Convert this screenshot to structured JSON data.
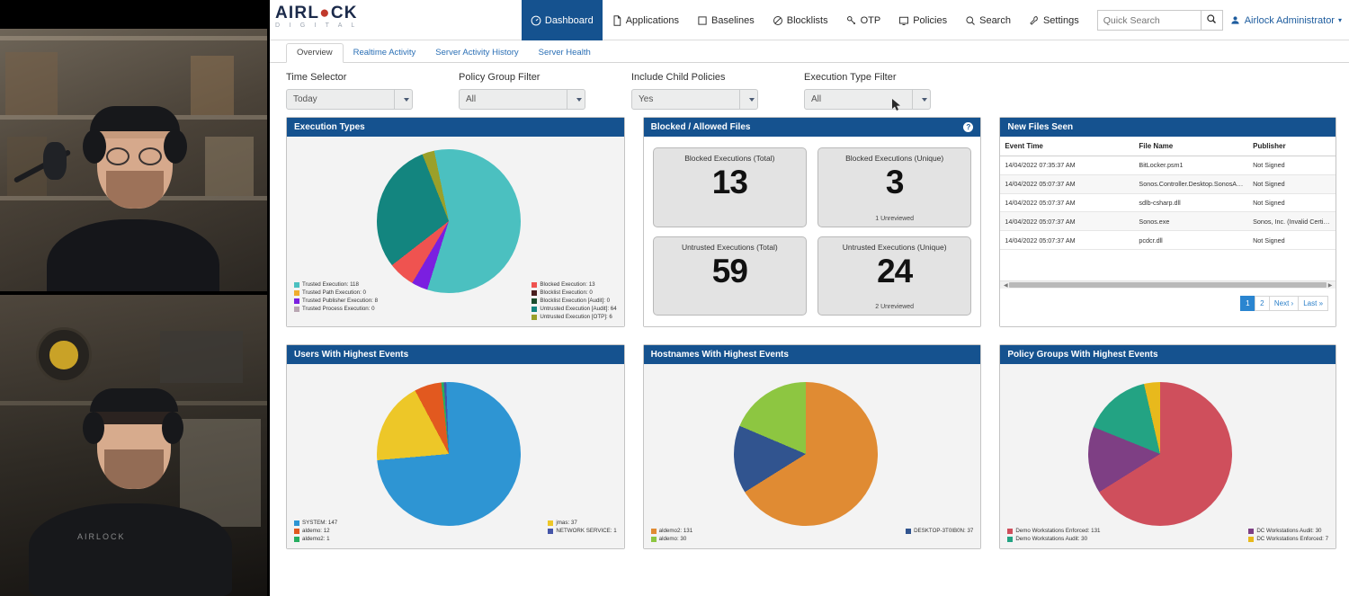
{
  "brand": {
    "name_a": "AIRL",
    "name_b": "CK",
    "tagline": "D I G I T A L"
  },
  "nav": {
    "items": [
      {
        "label": "Dashboard",
        "icon": "gauge-icon",
        "active": true
      },
      {
        "label": "Applications",
        "icon": "file-icon",
        "active": false
      },
      {
        "label": "Baselines",
        "icon": "square-icon",
        "active": false
      },
      {
        "label": "Blocklists",
        "icon": "ban-icon",
        "active": false
      },
      {
        "label": "OTP",
        "icon": "key-icon",
        "active": false
      },
      {
        "label": "Policies",
        "icon": "monitor-icon",
        "active": false
      },
      {
        "label": "Search",
        "icon": "search-icon",
        "active": false
      },
      {
        "label": "Settings",
        "icon": "wrench-icon",
        "active": false
      }
    ],
    "search": {
      "placeholder": "Quick Search",
      "value": "",
      "button_icon": "search-icon"
    },
    "user": {
      "label": "Airlock Administrator",
      "icon": "user-icon",
      "caret": "▾"
    }
  },
  "tabs": [
    {
      "label": "Overview",
      "active": true
    },
    {
      "label": "Realtime Activity",
      "active": false
    },
    {
      "label": "Server Activity History",
      "active": false
    },
    {
      "label": "Server Health",
      "active": false
    }
  ],
  "filters": [
    {
      "label": "Time Selector",
      "value": "Today"
    },
    {
      "label": "Policy Group Filter",
      "value": "All"
    },
    {
      "label": "Include Child Policies",
      "value": "Yes"
    },
    {
      "label": "Execution Type Filter",
      "value": "All"
    }
  ],
  "panels": {
    "execution_types": {
      "title": "Execution Types"
    },
    "blocked_allowed": {
      "title": "Blocked / Allowed Files",
      "help": "?"
    },
    "new_files": {
      "title": "New Files Seen"
    },
    "users": {
      "title": "Users With Highest Events"
    },
    "hostnames": {
      "title": "Hostnames With Highest Events"
    },
    "policy_groups": {
      "title": "Policy Groups With Highest Events"
    }
  },
  "metrics": [
    {
      "title": "Blocked Executions (Total)",
      "value": "13",
      "sub": ""
    },
    {
      "title": "Blocked Executions (Unique)",
      "value": "3",
      "sub": "1 Unreviewed"
    },
    {
      "title": "Untrusted Executions (Total)",
      "value": "59",
      "sub": ""
    },
    {
      "title": "Untrusted Executions (Unique)",
      "value": "24",
      "sub": "2 Unreviewed"
    }
  ],
  "new_files_table": {
    "columns": [
      "Event Time",
      "File Name",
      "Publisher"
    ],
    "rows": [
      {
        "time": "14/04/2022 07:35:37 AM",
        "file": "BitLocker.psm1",
        "publisher": "Not Signed"
      },
      {
        "time": "14/04/2022 05:07:37 AM",
        "file": "Sonos.Controller.Desktop.SonosAdm.Glue.dll",
        "publisher": "Not Signed"
      },
      {
        "time": "14/04/2022 05:07:37 AM",
        "file": "sdlb-csharp.dll",
        "publisher": "Not Signed"
      },
      {
        "time": "14/04/2022 05:07:37 AM",
        "file": "Sonos.exe",
        "publisher": "Sonos, Inc. (Invalid Certificate Cha"
      },
      {
        "time": "14/04/2022 05:07:37 AM",
        "file": "pcdcr.dll",
        "publisher": "Not Signed"
      }
    ],
    "pager": [
      {
        "label": "1",
        "active": true
      },
      {
        "label": "2",
        "active": false
      },
      {
        "label": "Next ›",
        "active": false
      },
      {
        "label": "Last »",
        "active": false
      }
    ]
  },
  "chart_data": [
    {
      "type": "pie",
      "title": "Execution Types",
      "legend_position": "bottom",
      "categories": [
        "Trusted Execution",
        "Trusted Path Execution",
        "Trusted Publisher Execution",
        "Trusted Process Execution",
        "Blocked Execution",
        "Blocklist Execution",
        "Blocklist Execution [Audit]",
        "Untrusted Execution [Audit]",
        "Untrusted Execution [OTP]"
      ],
      "values": [
        118,
        0,
        8,
        0,
        13,
        0,
        0,
        64,
        6
      ],
      "labels": [
        "Trusted Execution: 118",
        "Trusted Path Execution: 0",
        "Trusted Publisher Execution: 8",
        "Trusted Process Execution: 0",
        "Blocked Execution: 13",
        "Blocklist Execution: 0",
        "Blocklist Execution [Audit]: 0",
        "Untrusted Execution [Audit]: 64",
        "Untrusted Execution [OTP]: 6"
      ],
      "colors": [
        "#4bc0c0",
        "#f0ad2e",
        "#7b1fe0",
        "#b9a6b2",
        "#ef5350",
        "#4a1f1f",
        "#1b4d2e",
        "#13857f",
        "#9aa02a"
      ]
    },
    {
      "type": "pie",
      "title": "Users With Highest Events",
      "legend_position": "bottom",
      "categories": [
        "SYSTEM",
        "aldemo",
        "aldemo2",
        "jmas",
        "NETWORK SERVICE"
      ],
      "values": [
        147,
        12,
        1,
        37,
        1
      ],
      "labels": [
        "SYSTEM: 147",
        "aldemo: 12",
        "aldemo2: 1",
        "jmas: 37",
        "NETWORK SERVICE: 1"
      ],
      "colors": [
        "#2e95d3",
        "#e2591f",
        "#27ae60",
        "#edc728",
        "#4455a8"
      ]
    },
    {
      "type": "pie",
      "title": "Hostnames With Highest Events",
      "legend_position": "bottom",
      "categories": [
        "aldemo2",
        "aldemo",
        "DESKTOP-3T0IB0N"
      ],
      "values": [
        131,
        30,
        37
      ],
      "labels": [
        "aldemo2: 131",
        "aldemo: 30",
        "DESKTOP-3T0IB0N: 37"
      ],
      "colors": [
        "#e08b33",
        "#8dc641",
        "#31548f"
      ]
    },
    {
      "type": "pie",
      "title": "Policy Groups With Highest Events",
      "legend_position": "bottom",
      "categories": [
        "Demo Workstations Enforced",
        "Demo Workstations Audit",
        "DC Workstations Audit",
        "DC Workstations Enforced"
      ],
      "values": [
        131,
        30,
        30,
        7
      ],
      "labels": [
        "Demo Workstations Enforced: 131",
        "Demo Workstations Audit: 30",
        "DC Workstations Audit: 30",
        "DC Workstations Enforced: 7"
      ],
      "colors": [
        "#cf4f5c",
        "#23a383",
        "#7e3f84",
        "#e8b91c"
      ]
    }
  ],
  "theme": {
    "header_blue": "#15528f",
    "link_blue": "#2a7fc9",
    "panel_bg": "#f3f3f3"
  },
  "video": {
    "top_participant": "participant-upper",
    "bottom_participant": "participant-lower",
    "hoodie_logo": "AIRLOCK"
  }
}
